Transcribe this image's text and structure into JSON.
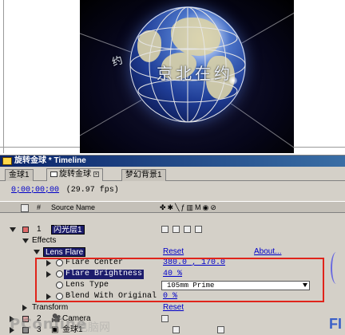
{
  "preview": {
    "globe_text_left": "约",
    "globe_text_right": "京北在约"
  },
  "window": {
    "title": "旋转金球 * Timeline"
  },
  "tabs": [
    {
      "label": "金球1",
      "active": false
    },
    {
      "label": "旋转金球",
      "active": true
    },
    {
      "label": "梦幻背景1",
      "active": false
    }
  ],
  "timecode": "0;00;00;00",
  "fps": "(29.97 fps)",
  "columns": {
    "number": "#",
    "source_name": "Source Name",
    "switches": "✤✱╲ƒ▥M◉⊘"
  },
  "layers": [
    {
      "number": "1",
      "name": "闪光层1",
      "color": "#e06a6a"
    },
    {
      "number": "2",
      "name": "Camera",
      "color": "#d8a0a0"
    },
    {
      "number": "3",
      "name": "金球1",
      "color": "#8a8a8a"
    }
  ],
  "effects_label": "Effects",
  "effect": {
    "name": "Lens Flare",
    "reset": "Reset",
    "about": "About...",
    "properties": [
      {
        "label": "Flare Center",
        "value": "380.0 , 170.0"
      },
      {
        "label": "Flare Brightness",
        "value": "40 %"
      },
      {
        "label": "Lens Type",
        "value": "105mm Prime"
      },
      {
        "label": "Blend With Original",
        "value": "0 %"
      }
    ]
  },
  "transform": {
    "label": "Transform",
    "reset": "Reset"
  },
  "watermark": {
    "left": "PConline",
    "middle": "电脑网",
    "logo": "FI"
  }
}
